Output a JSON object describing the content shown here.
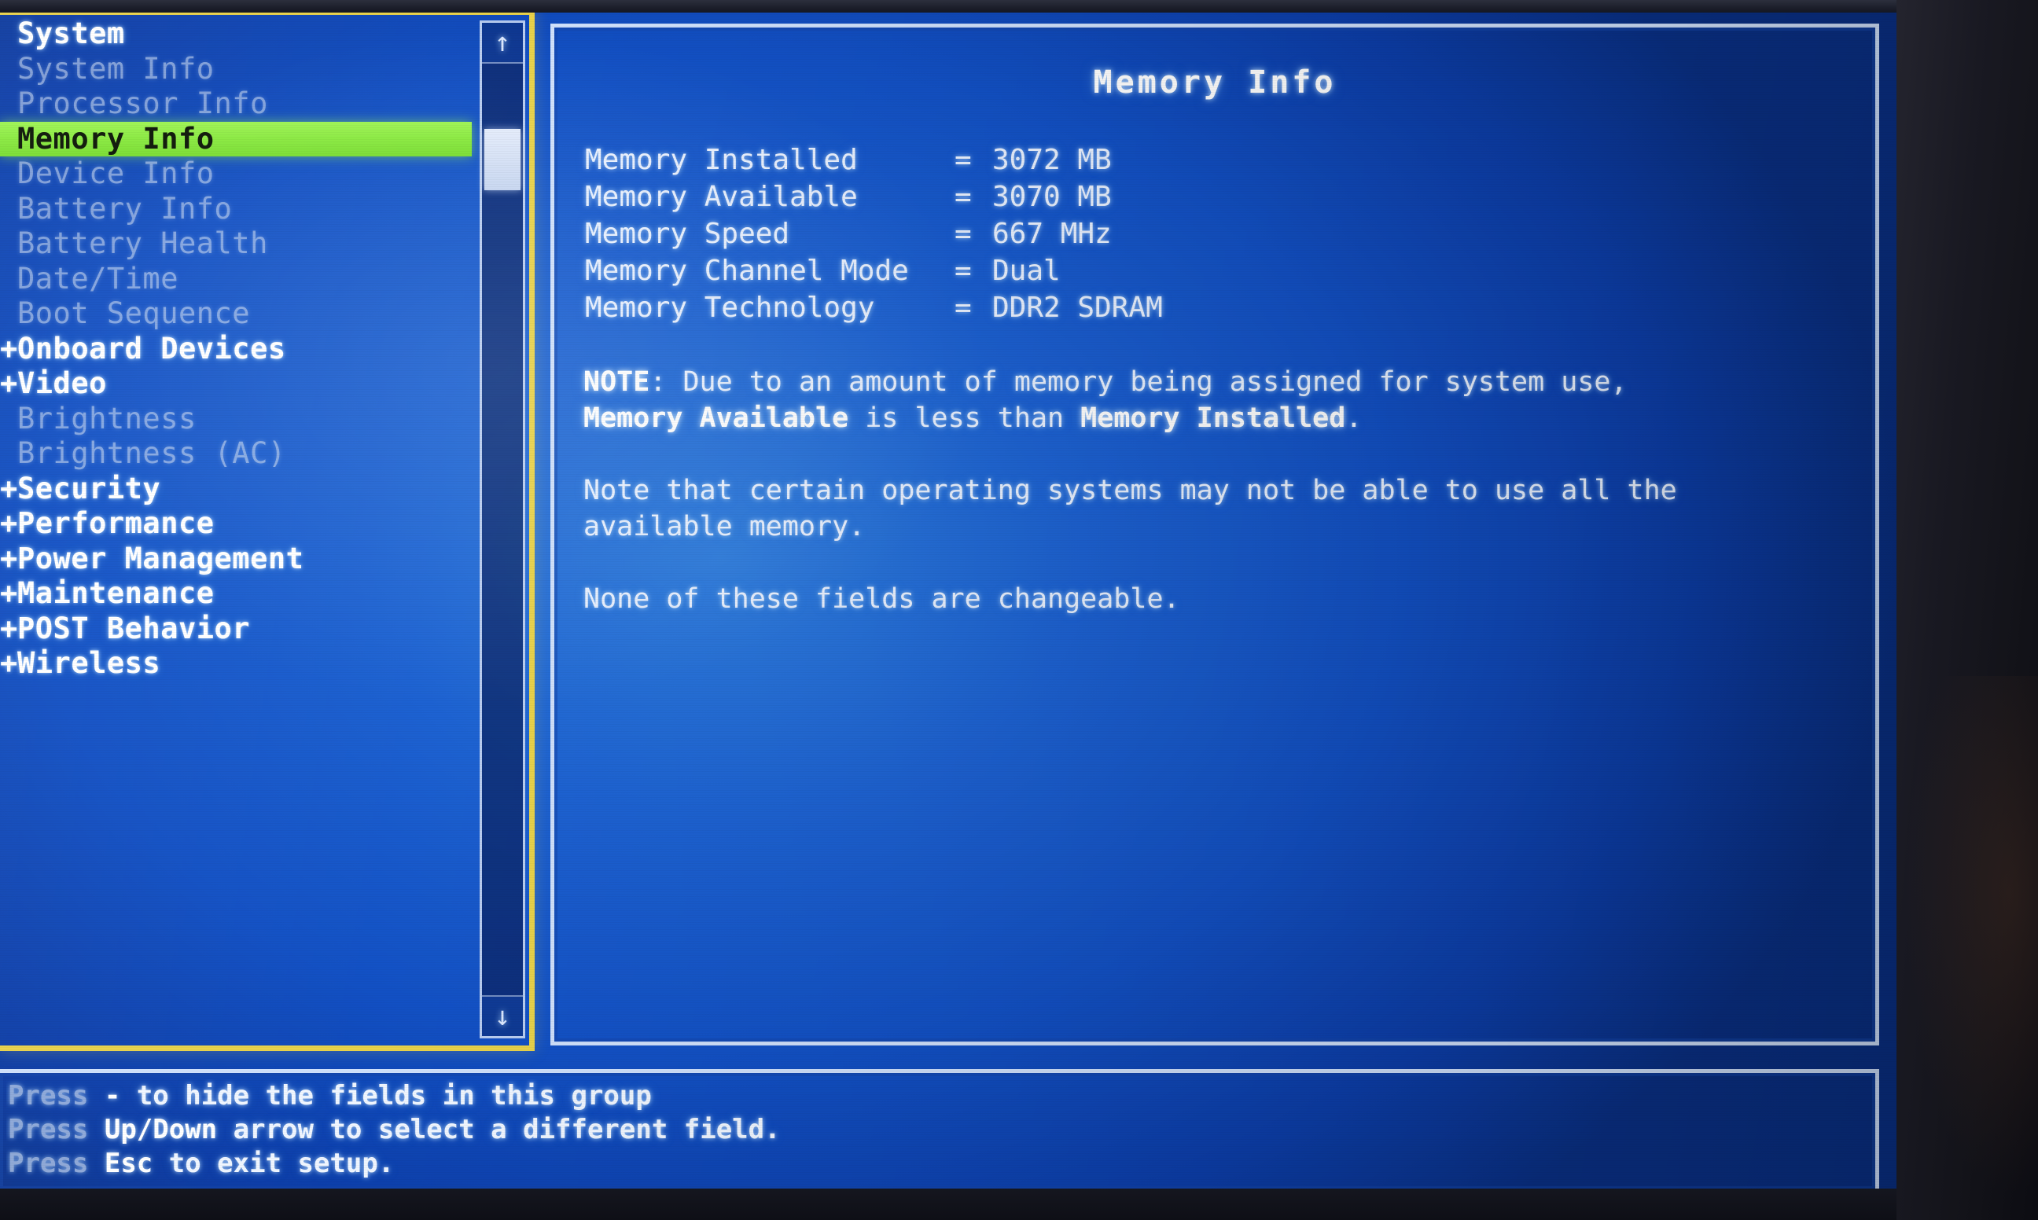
{
  "sidebar": {
    "items": [
      {
        "label": "System",
        "prefix": "",
        "level": "root",
        "state": "group"
      },
      {
        "label": "System Info",
        "prefix": "",
        "level": "child",
        "state": "child"
      },
      {
        "label": "Processor Info",
        "prefix": "",
        "level": "child",
        "state": "child"
      },
      {
        "label": "Memory Info",
        "prefix": "",
        "level": "child",
        "state": "selected"
      },
      {
        "label": "Device Info",
        "prefix": "",
        "level": "child",
        "state": "child"
      },
      {
        "label": "Battery Info",
        "prefix": "",
        "level": "child",
        "state": "child"
      },
      {
        "label": "Battery Health",
        "prefix": "",
        "level": "child",
        "state": "child"
      },
      {
        "label": "Date/Time",
        "prefix": "",
        "level": "child",
        "state": "child"
      },
      {
        "label": "Boot Sequence",
        "prefix": "",
        "level": "child",
        "state": "child"
      },
      {
        "label": "Onboard Devices",
        "prefix": "+",
        "level": "group",
        "state": "group"
      },
      {
        "label": "Video",
        "prefix": "+",
        "level": "group",
        "state": "group"
      },
      {
        "label": "Brightness",
        "prefix": "",
        "level": "child",
        "state": "child"
      },
      {
        "label": "Brightness (AC)",
        "prefix": "",
        "level": "child",
        "state": "child"
      },
      {
        "label": "Security",
        "prefix": "+",
        "level": "group",
        "state": "group"
      },
      {
        "label": "Performance",
        "prefix": "+",
        "level": "group",
        "state": "group"
      },
      {
        "label": "Power Management",
        "prefix": "+",
        "level": "group",
        "state": "group"
      },
      {
        "label": "Maintenance",
        "prefix": "+",
        "level": "group",
        "state": "group"
      },
      {
        "label": "POST Behavior",
        "prefix": "+",
        "level": "group",
        "state": "group"
      },
      {
        "label": "Wireless",
        "prefix": "+",
        "level": "group",
        "state": "group"
      }
    ],
    "scrollbar": {
      "up_arrow": "up-arrow-icon",
      "down_arrow": "down-arrow-icon",
      "up_glyph": "↑",
      "down_glyph": "↓"
    }
  },
  "main": {
    "title": "Memory Info",
    "fields": [
      {
        "label": "Memory Installed",
        "eq": "=",
        "value": "3072 MB"
      },
      {
        "label": "Memory Available",
        "eq": "=",
        "value": "3070 MB"
      },
      {
        "label": "Memory Speed",
        "eq": "=",
        "value": "667 MHz"
      },
      {
        "label": "Memory Channel Mode",
        "eq": "=",
        "value": "Dual"
      },
      {
        "label": "Memory Technology",
        "eq": "=",
        "value": "DDR2 SDRAM"
      }
    ],
    "note": {
      "bold_lead": "NOTE",
      "line1_a": ": Due to an amount of memory being assigned for system use,",
      "line2_b1": "Memory Available",
      "line2_mid": " is less than ",
      "line2_b2": "Memory Installed",
      "line2_end": "."
    },
    "paragraph2": "Note that certain operating systems may not be able to use all the available memory.",
    "paragraph3": "None of these fields are changeable."
  },
  "help": {
    "line1_prefix": "Press",
    "line1_key": "-",
    "line1_rest": "to hide the fields in this group",
    "line2_prefix": "Press",
    "line2_key": "Up/Down",
    "line2_rest": "arrow to select a different field.",
    "line3_prefix": "Press",
    "line3_key": "Esc",
    "line3_rest": "to exit setup."
  },
  "colors": {
    "selection_green": "#8ee83c",
    "focus_yellow": "#e8d24a",
    "screen_blue": "#1250c4",
    "border_light": "#cfe0fb"
  }
}
